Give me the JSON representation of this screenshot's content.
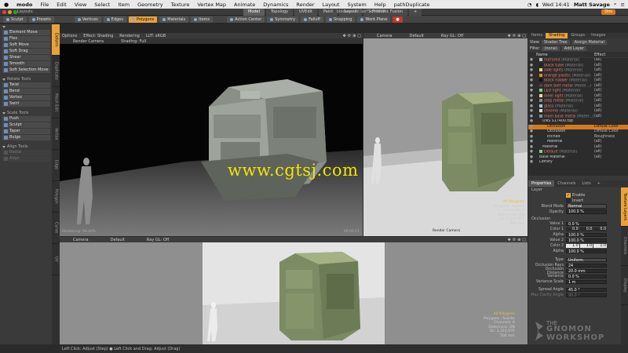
{
  "menubar": {
    "apple": "",
    "items": [
      "modo",
      "File",
      "Edit",
      "View",
      "Select",
      "Item",
      "Geometry",
      "Texture",
      "Vertex Map",
      "Animate",
      "Dynamics",
      "Render",
      "Layout",
      "System",
      "Help",
      "pathDuplicate"
    ],
    "clock": "Wed 14:41",
    "user": "Matt Savage"
  },
  "titlebar": {
    "app": "Layouts",
    "tabs": [
      "Model",
      "Topology",
      "UVEdit",
      "Paint",
      "Layout",
      "Schematic Fusion"
    ],
    "active_tab": "Model",
    "document": "blockmodel.lxo* - MODO",
    "path_button": "Ons"
  },
  "toolbar": {
    "left": [
      "Sculpt",
      "Presets"
    ],
    "modes": [
      "Vertices",
      "Edges",
      "Polygons",
      "Materials",
      "Items"
    ],
    "active_mode": "Polygons",
    "center": [
      "Action Center",
      "Symmetry",
      "Falloff",
      "Snapping",
      "Work Plane"
    ]
  },
  "left_panel": {
    "groups": [
      {
        "title": "",
        "items": [
          "Element Move",
          "Flex",
          "Soft Move",
          "Soft Drag",
          "Shear",
          "Smooth",
          "Soft Selection Move"
        ]
      },
      {
        "title": "Rotate Tools",
        "items": [
          "Twist",
          "Bend",
          "Vortex",
          "Swirl"
        ]
      },
      {
        "title": "Scale Tools",
        "items": [
          "Push",
          "Sculpt",
          "Taper",
          "Bulge"
        ]
      },
      {
        "title": "Align Tools",
        "items": [
          "Radial",
          "Align"
        ]
      }
    ],
    "disabled": [
      "Radial",
      "Align"
    ],
    "vertical_tabs": [
      "Deform",
      "Duplicate",
      "Mesh Edit",
      "Vertex",
      "Edge",
      "Polygon",
      "Curve",
      "UV"
    ]
  },
  "viewport_main": {
    "bar": [
      "Options",
      "Effect: Shading",
      "Rendering",
      "LUT: sRGB"
    ],
    "bar2": [
      "Render Camera",
      "Shading: Full"
    ],
    "footer_left": "Rendering: 94.44%",
    "footer_right": "00:00:11"
  },
  "viewport_top_right": {
    "bar": [
      "Camera",
      "Default",
      "Ray GL: Off"
    ],
    "footer": "Render Camera"
  },
  "viewport_bottom": {
    "bar": [
      "Camera",
      "Default",
      "Ray GL: Off"
    ],
    "info": [
      "All Polygons",
      "Polygons : Subdiv",
      "Channels: 0",
      "Deformers: ON",
      "GL: 1,314,976",
      "500 mm"
    ]
  },
  "viewport_info_tr": [
    "All Polygons",
    "Polygons : Subdiv",
    "Channels: 0",
    "Deformers: ON",
    "GL: 1,314,976",
    "500 mm"
  ],
  "right_panel": {
    "tabs": [
      "Items",
      "Shading",
      "Groups",
      "Images"
    ],
    "active_tab": "Shading",
    "view_label": "View",
    "view_value": "Shader Tree",
    "assign_button": "Assign Material",
    "filter_label": "Filter",
    "filter_value": "(none)",
    "add_layer": "Add Layer",
    "col_name": "Name",
    "col_effect": "Effect",
    "tree": [
      {
        "name": "mirrored",
        "tag": "(Material)",
        "effect": "(all)",
        "mat": true
      },
      {
        "name": "black tube",
        "tag": "(Material)",
        "effect": "(all)",
        "mat": true
      },
      {
        "name": "side lights",
        "tag": "(Material)",
        "effect": "(all)",
        "mat": true
      },
      {
        "name": "orange plastic",
        "tag": "(Material)",
        "effect": "(all)",
        "mat": true
      },
      {
        "name": "black rubber",
        "tag": "(Material)",
        "effect": "(all)",
        "mat": true
      },
      {
        "name": "dark bolt metal",
        "tag": "(Mater...)",
        "effect": "(all)",
        "mat": true
      },
      {
        "name": "LED light",
        "tag": "(Material)",
        "effect": "(all)",
        "mat": true
      },
      {
        "name": "inner light",
        "tag": "(Material)",
        "effect": "(all)",
        "mat": true
      },
      {
        "name": "step metal",
        "tag": "(Material)",
        "effect": "(all)",
        "mat": true
      },
      {
        "name": "glass",
        "tag": "(Material)",
        "effect": "(all)",
        "mat": true
      },
      {
        "name": "chrome",
        "tag": "(Material)",
        "effect": "(all)",
        "mat": true
      },
      {
        "name": "main base metal",
        "tag": "(Mater...)",
        "effect": "(all)",
        "mat": true
      },
      {
        "name": "UNS S17400.tsp",
        "tag": "",
        "effect": "",
        "mat": false
      },
      {
        "name": "Occlusion",
        "tag": "",
        "effect": "Diffuse Color",
        "mat": false,
        "selected": true
      },
      {
        "name": "Occlusion",
        "tag": "",
        "effect": "Diffuse Color",
        "mat": false
      },
      {
        "name": "Etched",
        "tag": "",
        "effect": "Roughness",
        "mat": false
      },
      {
        "name": "Material",
        "tag": "",
        "effect": "(all)",
        "mat": false
      },
      {
        "name": "Material",
        "tag": "",
        "effect": "(all)",
        "mat": false
      },
      {
        "name": "Default",
        "tag": "(Material)",
        "effect": "(all)",
        "mat": true
      },
      {
        "name": "Base Material",
        "tag": "",
        "effect": "(all)",
        "mat": false
      },
      {
        "name": "Library",
        "tag": "",
        "effect": "",
        "mat": false
      }
    ],
    "prop_tabs": [
      "Properties",
      "Channels",
      "Lists",
      "+"
    ],
    "active_prop_tab": "Properties",
    "props": {
      "layer_section": "Layer",
      "enable_label": "Enable",
      "invert_label": "Invert",
      "blend_mode_label": "Blend Mode",
      "blend_mode": "Normal",
      "opacity_label": "Opacity",
      "opacity": "100.0 %",
      "occlusion_section": "Occlusion",
      "value1_label": "Value 1",
      "value1": "0.0 %",
      "color1_label": "Color 1",
      "color1": [
        "0.0",
        "0.0",
        "0.0"
      ],
      "alpha1_label": "Alpha",
      "alpha1": "100.0 %",
      "value2_label": "Value 2",
      "value2": "100.0 %",
      "color2_label": "Color 2",
      "color2": [
        "1.0",
        "1.0",
        "1.0"
      ],
      "alpha2_label": "Alpha",
      "alpha2": "100.0 %",
      "type_label": "Type",
      "type": "Uniform",
      "rays_label": "Occlusion Rays",
      "rays": "24",
      "distance_label": "Occlusion Distance",
      "distance": "20.0 mm",
      "variance_label": "Variance",
      "variance": "0.0 %",
      "variance_scale_label": "Variance Scale",
      "variance_scale": "1 m",
      "spread_label": "Spread Angle",
      "spread": "45.0 °",
      "max_cavity_label": "Max Cavity Angle",
      "max_cavity": "90.0 °"
    },
    "vertical_tabs": [
      "Texture Layers",
      "Channels",
      "Display"
    ]
  },
  "status": {
    "text": "Left Click: Adjust (Step) ● Left Click and Drag: Adjust (Drag)"
  },
  "watermark": "www.cgtsj.com",
  "logo": {
    "line1": "THE",
    "line2": "GNOMON",
    "line3": "WORKSHOP"
  },
  "colors": {
    "accent": "#e8a33a",
    "selection": "#d37a1c",
    "material_text": "#e87a6c",
    "watermark": "#f2e400"
  }
}
